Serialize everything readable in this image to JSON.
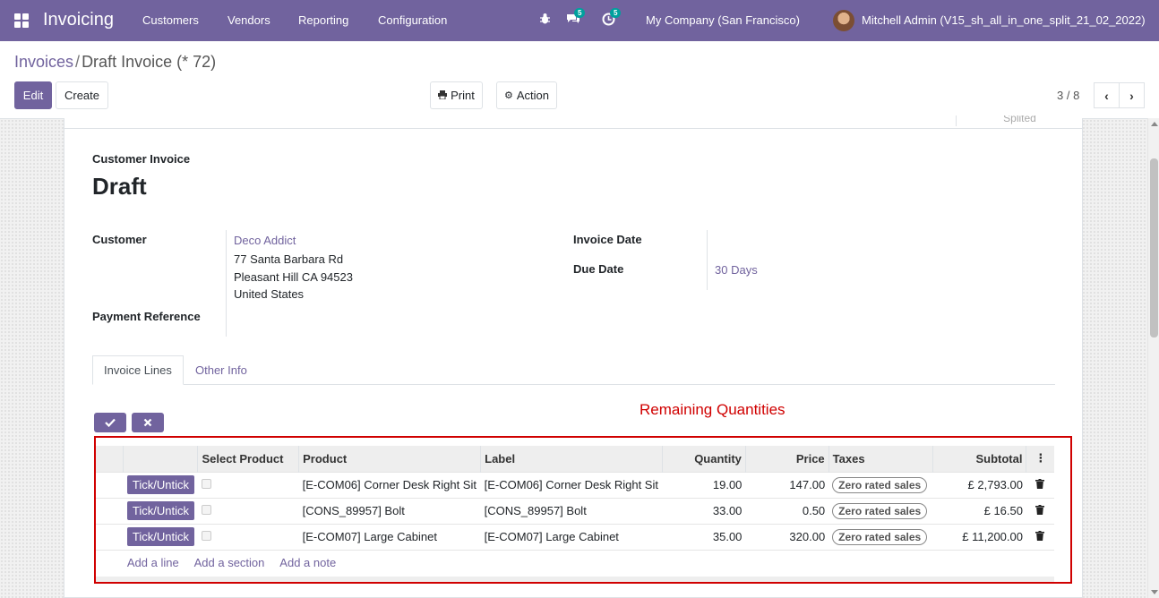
{
  "navbar": {
    "app_name": "Invoicing",
    "menu": [
      "Customers",
      "Vendors",
      "Reporting",
      "Configuration"
    ],
    "messages_badge": "5",
    "activity_badge": "5",
    "company": "My Company (San Francisco)",
    "user": "Mitchell Admin (V15_sh_all_in_one_split_21_02_2022)",
    "color": "#71639e"
  },
  "breadcrumb": {
    "parent": "Invoices",
    "separator": "/",
    "current": "Draft Invoice (* 72)"
  },
  "toolbar": {
    "edit_label": "Edit",
    "create_label": "Create",
    "print_label": "Print",
    "action_label": "Action"
  },
  "pager": {
    "text": "3 / 8"
  },
  "sheet": {
    "ribbon_hint": "Splited",
    "doc_type": "Customer Invoice",
    "state_title": "Draft",
    "customer_label": "Customer",
    "customer_name": "Deco Addict",
    "address_line1": "77 Santa Barbara Rd",
    "address_line2": "Pleasant Hill CA 94523",
    "address_line3": "United States",
    "payment_ref_label": "Payment Reference",
    "invoice_date_label": "Invoice Date",
    "due_date_label": "Due Date",
    "due_date_value": "30 Days"
  },
  "tabs": [
    "Invoice Lines",
    "Other Info"
  ],
  "remaining_label": "Remaining Quantities",
  "table": {
    "headers": [
      "Select Product",
      "Product",
      "Label",
      "Quantity",
      "Price",
      "Taxes",
      "Subtotal"
    ],
    "tick_label": "Tick/Untick",
    "rows": [
      {
        "product": "[E-COM06] Corner Desk Right Sit",
        "label": "[E-COM06] Corner Desk Right Sit",
        "quantity": "19.00",
        "price": "147.00",
        "tax": "Zero rated sales",
        "subtotal": "£ 2,793.00"
      },
      {
        "product": "[CONS_89957] Bolt",
        "label": "[CONS_89957] Bolt",
        "quantity": "33.00",
        "price": "0.50",
        "tax": "Zero rated sales",
        "subtotal": "£ 16.50"
      },
      {
        "product": "[E-COM07] Large Cabinet",
        "label": "[E-COM07] Large Cabinet",
        "quantity": "35.00",
        "price": "320.00",
        "tax": "Zero rated sales",
        "subtotal": "£ 11,200.00"
      }
    ],
    "add_line": "Add a line",
    "add_section": "Add a section",
    "add_note": "Add a note"
  }
}
